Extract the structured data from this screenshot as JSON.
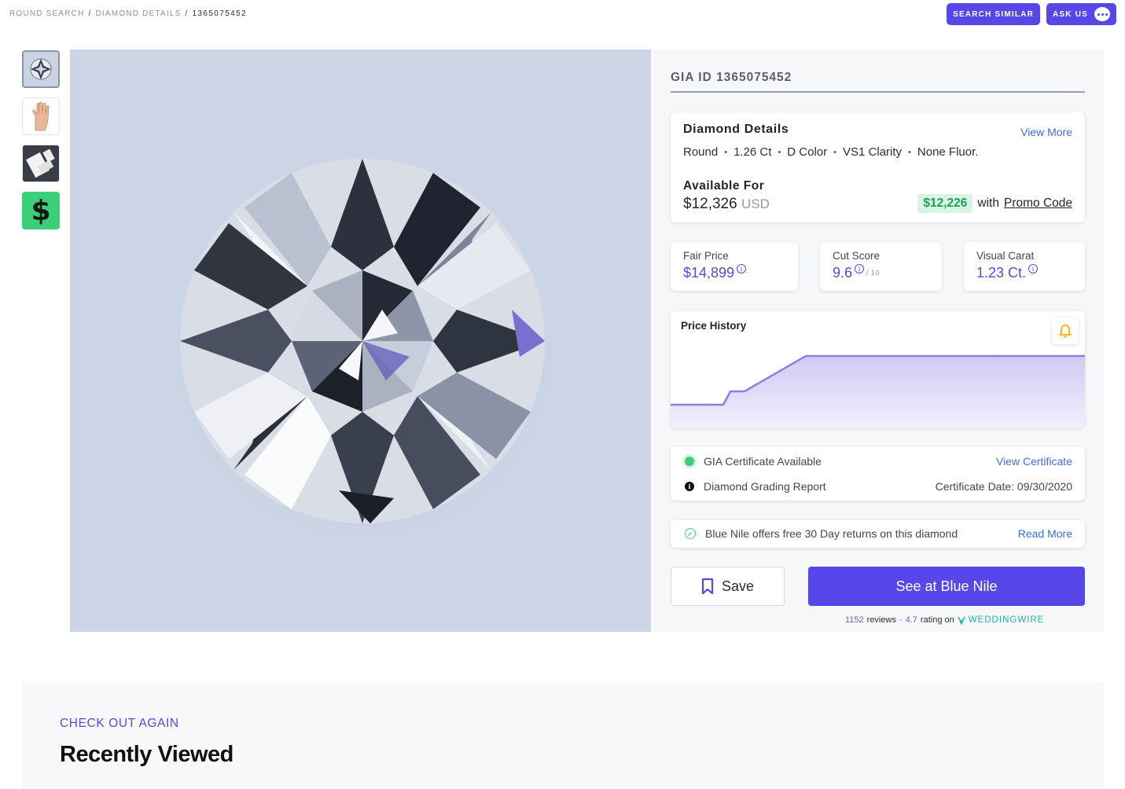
{
  "breadcrumb": {
    "items": [
      "ROUND SEARCH",
      "DIAMOND DETAILS"
    ],
    "separator": "/",
    "current": "1365075452"
  },
  "top_actions": {
    "search_similar": "SEARCH SIMILAR",
    "ask_us": "ASK US"
  },
  "thumbnails": [
    {
      "icon": "diamond-icon",
      "active": true
    },
    {
      "icon": "hand-icon",
      "active": false
    },
    {
      "icon": "certificate-icon",
      "active": false
    },
    {
      "icon": "dollar-icon",
      "label": "$",
      "active": false
    }
  ],
  "panel": {
    "gia_id": "GIA ID 1365075452",
    "details": {
      "title": "Diamond Details",
      "view_more": "View More",
      "specs": [
        "Round",
        "1.26 Ct",
        "D Color",
        "VS1 Clarity",
        "None Fluor."
      ],
      "available_label": "Available For",
      "price": "$12,326",
      "currency": "USD",
      "promo_price": "$12,226",
      "promo_with": "with",
      "promo_link": "Promo Code"
    },
    "metrics": [
      {
        "label": "Fair Price",
        "value": "$14,899",
        "sub": ""
      },
      {
        "label": "Cut Score",
        "value": "9.6",
        "sub": "/ 10"
      },
      {
        "label": "Visual Carat",
        "value": "1.23 Ct.",
        "sub": ""
      }
    ],
    "price_history": {
      "title": "Price History",
      "line_color": "#8b7fe0"
    },
    "certificate": {
      "available": "GIA Certificate Available",
      "view_link": "View Certificate",
      "report": "Diamond Grading Report",
      "date": "Certificate Date: 09/30/2020"
    },
    "returns": {
      "text": "Blue Nile offers free 30 Day returns on this diamond",
      "link": "Read More"
    },
    "save_label": "Save",
    "buy_label": "See at Blue Nile",
    "reviews": {
      "count": "1152",
      "reviews_word": "reviews",
      "dot": "·",
      "rating": "4.7",
      "rating_on": "rating on",
      "brand": "WEDDINGWIRE"
    }
  },
  "recently_viewed": {
    "eyebrow": "CHECK OUT AGAIN",
    "title": "Recently Viewed"
  },
  "colors": {
    "accent": "#5746e8",
    "link": "#3c6fd6",
    "success": "#3ccf7a"
  }
}
